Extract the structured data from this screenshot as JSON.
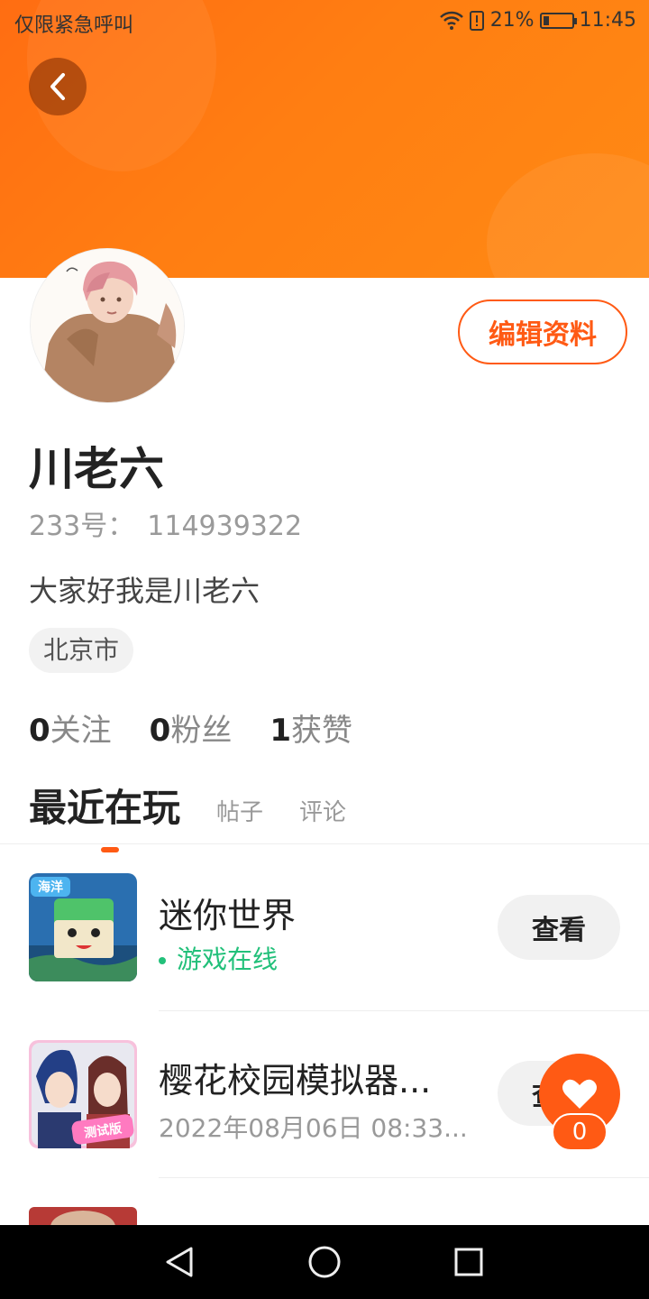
{
  "status_bar": {
    "carrier_text": "仅限紧急呼叫",
    "battery_percent_text": "21%",
    "battery_level": 0.21,
    "time": "11:45",
    "icons": [
      "wifi-icon",
      "sim-alert-icon",
      "battery-saver-icon"
    ]
  },
  "header": {
    "back_icon": "chevron-left-icon",
    "banner_color": "#ff7a12"
  },
  "profile": {
    "edit_label": "编辑资料",
    "username": "川老六",
    "id_label": "233号：",
    "id_value": "114939322",
    "bio": "大家好我是川老六",
    "location": "北京市"
  },
  "stats": [
    {
      "value": "0",
      "label": "关注"
    },
    {
      "value": "0",
      "label": "粉丝"
    },
    {
      "value": "1",
      "label": "获赞"
    }
  ],
  "tabs": {
    "active": "最近在玩",
    "others": [
      "帖子",
      "评论"
    ]
  },
  "games": [
    {
      "name": "迷你世界",
      "status": "游戏在线",
      "action": "查看"
    },
    {
      "name": "樱花校园模拟器...",
      "time": "2022年08月06日 08:33...",
      "action": "查看"
    }
  ],
  "like_fab": {
    "icon": "heart-icon",
    "count": "0"
  },
  "nav_bar": {
    "icons": [
      "back-triangle-icon",
      "home-circle-icon",
      "recents-square-icon"
    ]
  },
  "colors": {
    "accent": "#ff5a14",
    "online": "#22c07a"
  }
}
